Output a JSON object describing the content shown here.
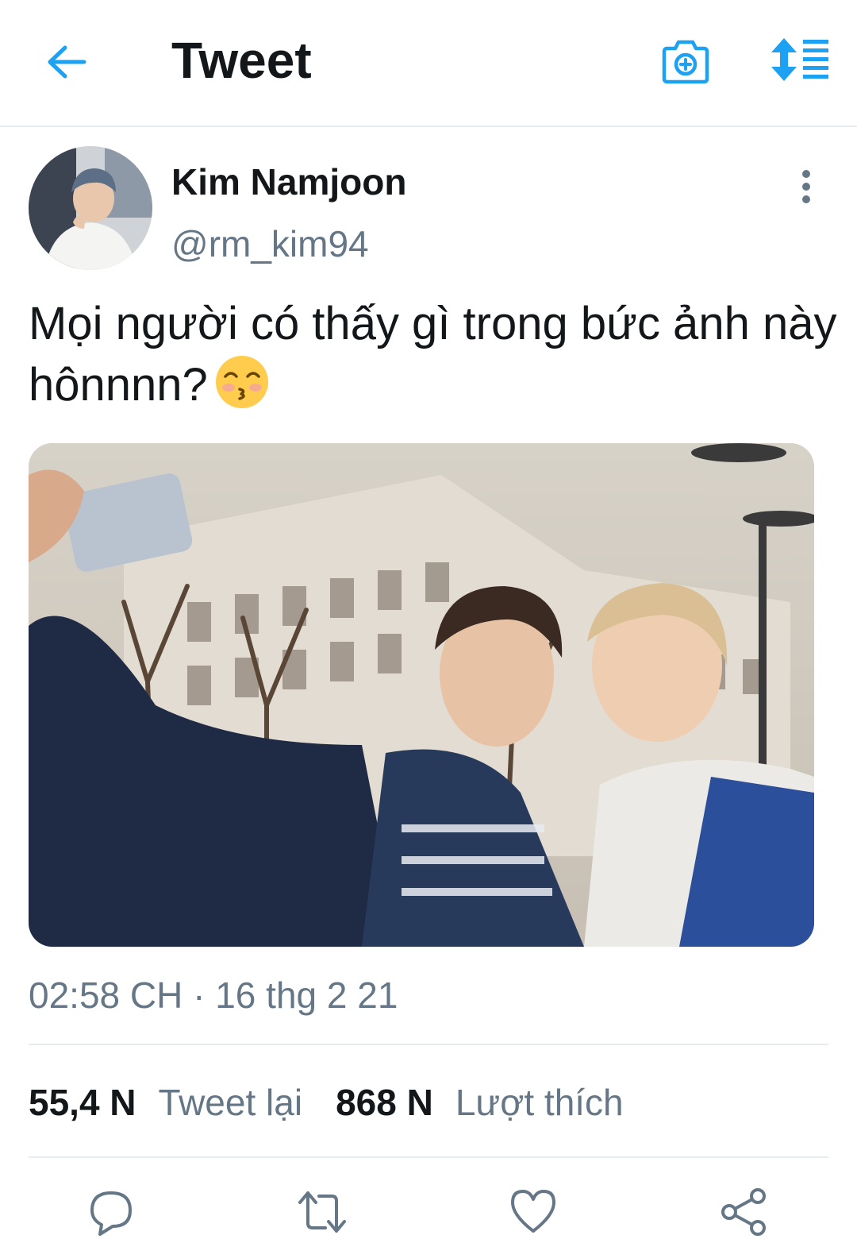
{
  "header": {
    "title": "Tweet",
    "back_icon": "arrow-left-icon",
    "camera_icon": "camera-plus-icon",
    "sort_icon": "sort-arrows-icon",
    "accent_color": "#1da1f2"
  },
  "author": {
    "name": "Kim Namjoon",
    "handle": "@rm_kim94",
    "avatar": "avatar-photo"
  },
  "tweet": {
    "text": "Mọi người có thấy gì trong bức ảnh này hônnnn?",
    "emoji": "kissing-face-with-smiling-eyes"
  },
  "media": {
    "kind": "photo"
  },
  "meta": {
    "timestamp": "02:58 CH · 16 thg 2 21"
  },
  "stats": {
    "retweets_count": "55,4 N",
    "retweets_label": "Tweet lại",
    "likes_count": "868 N",
    "likes_label": "Lượt thích"
  },
  "actions": {
    "reply_icon": "reply-icon",
    "retweet_icon": "retweet-icon",
    "like_icon": "heart-icon",
    "share_icon": "share-icon"
  },
  "colors": {
    "text_primary": "#14171a",
    "text_secondary": "#657786",
    "divider": "#e6ecf0"
  }
}
